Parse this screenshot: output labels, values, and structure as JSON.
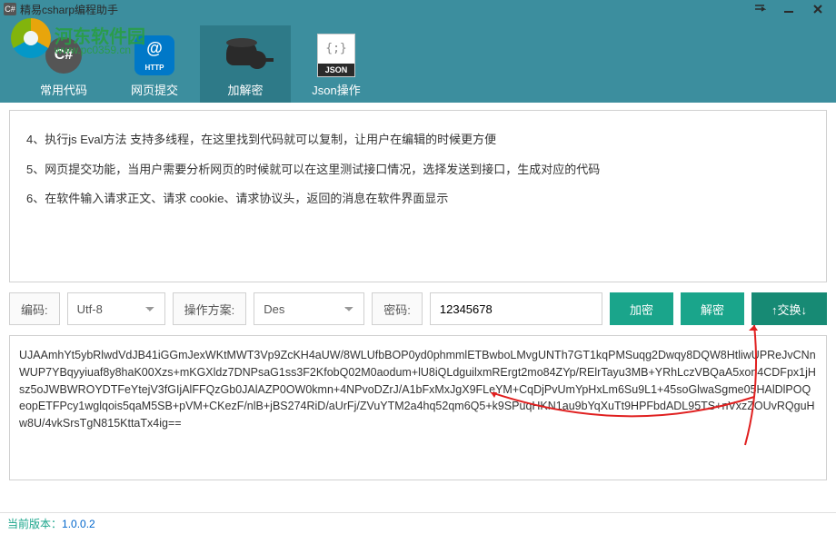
{
  "title": "精易csharp编程助手",
  "toolbar": {
    "items": [
      {
        "label": "常用代码",
        "icon": "csharp"
      },
      {
        "label": "网页提交",
        "icon": "http"
      },
      {
        "label": "加解密",
        "icon": "crypt",
        "active": true
      },
      {
        "label": "Json操作",
        "icon": "json"
      }
    ]
  },
  "description": {
    "line1": "4、执行js Eval方法 支持多线程，在这里找到代码就可以复制，让用户在编辑的时候更方便",
    "line2": "5、网页提交功能，当用户需要分析网页的时候就可以在这里测试接口情况，选择发送到接口，生成对应的代码",
    "line3": "6、在软件输入请求正文、请求 cookie、请求协议头，返回的消息在软件界面显示"
  },
  "controls": {
    "encoding_label": "编码:",
    "encoding_value": "Utf-8",
    "scheme_label": "操作方案:",
    "scheme_value": "Des",
    "password_label": "密码:",
    "password_value": "12345678",
    "encrypt_btn": "加密",
    "decrypt_btn": "解密",
    "swap_btn": "↑交换↓"
  },
  "output": "UJAAmhYt5ybRlwdVdJB41iGGmJexWKtMWT3Vp9ZcKH4aUW/8WLUfbBOP0yd0phmmlETBwboLMvgUNTh7GT1kqPMSuqg2Dwqy8DQW8HtliwUPReJvCNnWUP7YBqyyiuaf8y8haK00Xzs+mKGXldz7DNPsaG1ss3F2KfobQ02M0aodum+lU8iQLdguilxmRErgt2mo84ZYp/RElrTayu3MB+YRhLczVBQaA5xon4CDFpx1jHsz5oJWBWROYDTFeYtejV3fGIjAlFFQzGb0JAlAZP0OW0kmn+4NPvoDZrJ/A1bFxMxJgX9FLeYM+CqDjPvUmYpHxLm6Su9L1+45soGlwaSgme05HAlDlPOQeopETFPcy1wglqois5qaM5SB+pVM+CKezF/nlB+jBS274RiD/aUrFj/ZVuYTM2a4hq52qm6Q5+k9SPuqHKN1au9bYqXuTt9HPFbdADL95TS+nVxzZOUvRQguHw8U/4vkSrsTgN815KttaTx4ig==",
  "status": {
    "label": "当前版本：",
    "version": "1.0.0.2"
  },
  "watermark": {
    "line1": "河东软件园",
    "line2": "www.pc0359.cn"
  }
}
